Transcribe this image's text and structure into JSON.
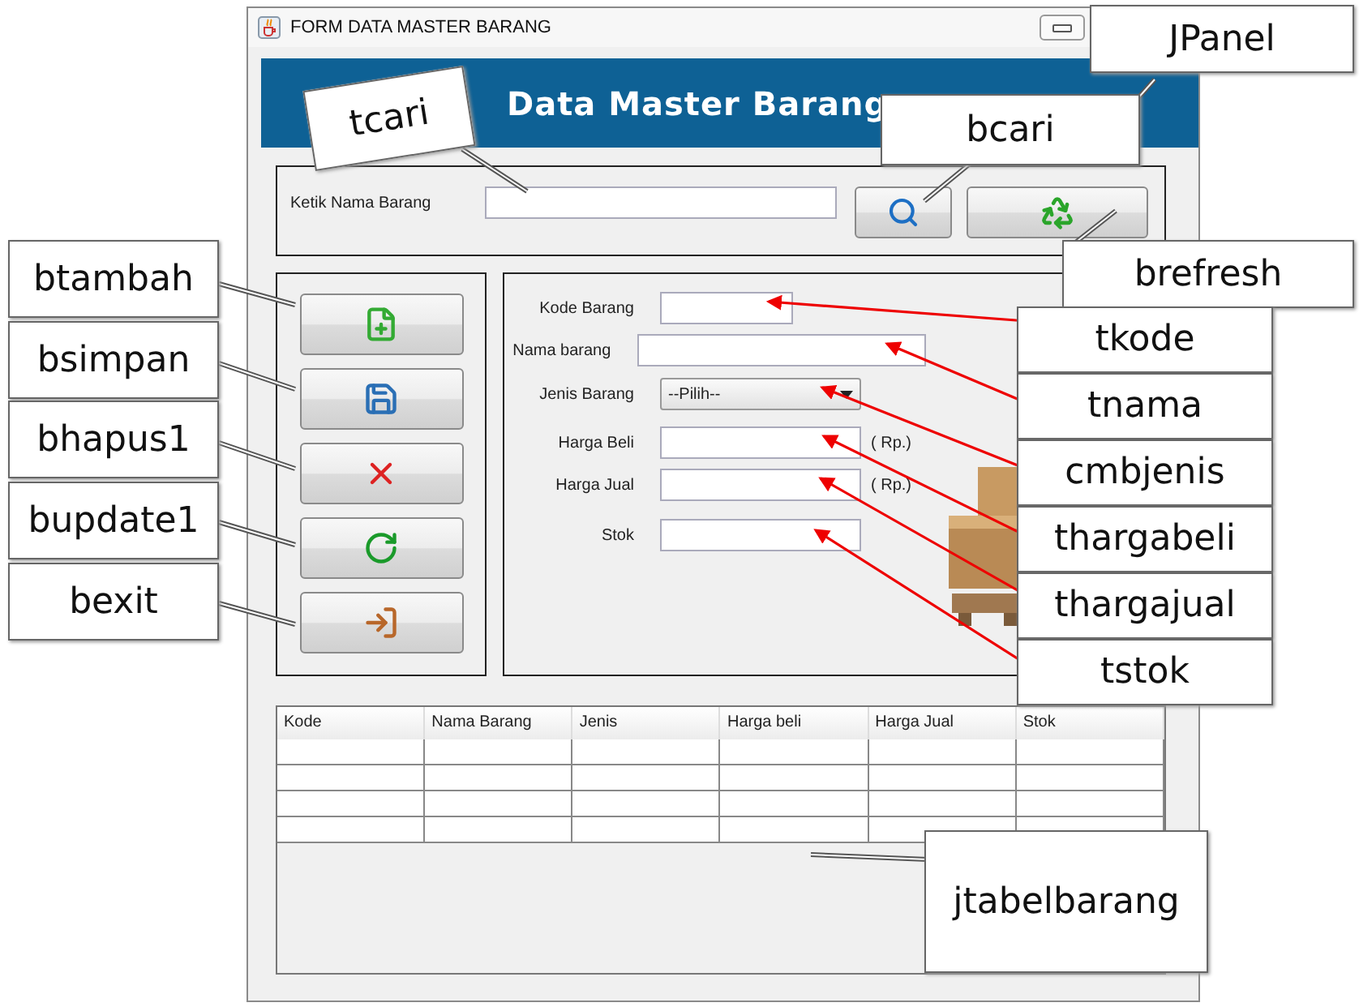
{
  "window": {
    "title": "FORM DATA MASTER BARANG"
  },
  "header": {
    "title": "Data Master Barang"
  },
  "search": {
    "label": "Ketik  Nama Barang"
  },
  "form": {
    "fields": [
      {
        "label": "Kode Barang",
        "kind": "text"
      },
      {
        "label": "Nama barang",
        "kind": "text"
      },
      {
        "label": "Jenis Barang",
        "kind": "combo",
        "value": "--Pilih--"
      },
      {
        "label": "Harga Beli",
        "kind": "currency",
        "suffix": "( Rp.)"
      },
      {
        "label": "Harga Jual",
        "kind": "currency",
        "suffix": "( Rp.)"
      },
      {
        "label": "Stok",
        "kind": "text"
      }
    ]
  },
  "table": {
    "columns": [
      "Kode",
      "Nama Barang",
      "Jenis",
      "Harga beli",
      "Harga Jual",
      "Stok"
    ]
  },
  "annotations": [
    {
      "text": "JPanel",
      "kind": "callout"
    },
    {
      "text": "tcari",
      "kind": "callout"
    },
    {
      "text": "bcari",
      "kind": "callout"
    },
    {
      "text": "brefresh",
      "kind": "callout"
    },
    {
      "text": "btambah",
      "kind": "callout"
    },
    {
      "text": "bsimpan",
      "kind": "callout"
    },
    {
      "text": "bhapus1",
      "kind": "callout"
    },
    {
      "text": "bupdate1",
      "kind": "callout"
    },
    {
      "text": "bexit",
      "kind": "callout"
    },
    {
      "text": "tkode",
      "kind": "arrow"
    },
    {
      "text": "tnama",
      "kind": "arrow"
    },
    {
      "text": "cmbjenis",
      "kind": "arrow"
    },
    {
      "text": "thargabeli",
      "kind": "arrow"
    },
    {
      "text": "thargajual",
      "kind": "arrow"
    },
    {
      "text": "tstok",
      "kind": "arrow"
    },
    {
      "text": "jtabelbarang",
      "kind": "callout"
    }
  ]
}
